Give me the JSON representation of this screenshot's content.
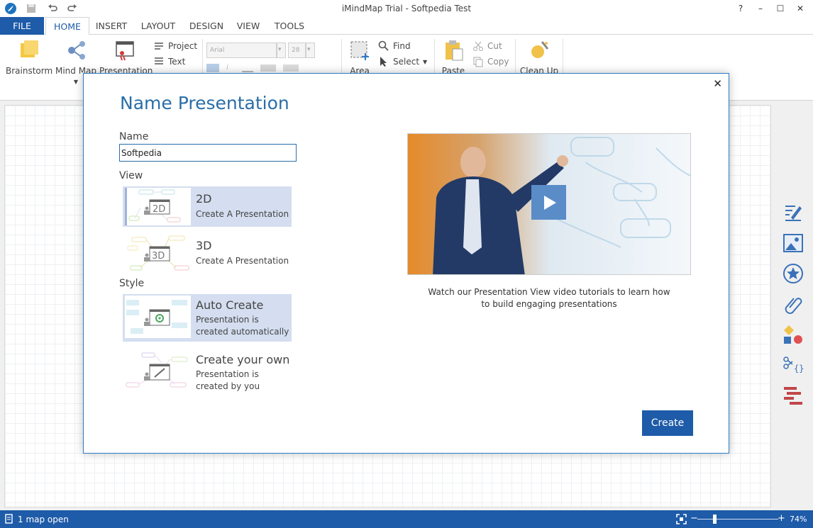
{
  "window": {
    "title": "iMindMap Trial - Softpedia Test"
  },
  "titlebar": {
    "help": "?",
    "minimize": "–",
    "maximize": "☐",
    "close": "✕"
  },
  "ribbon_tabs": [
    {
      "label": "FILE"
    },
    {
      "label": "HOME"
    },
    {
      "label": "INSERT"
    },
    {
      "label": "LAYOUT"
    },
    {
      "label": "DESIGN"
    },
    {
      "label": "VIEW"
    },
    {
      "label": "TOOLS"
    }
  ],
  "ribbon": {
    "brainstorm": "Brainstorm",
    "mind_map": "Mind Map",
    "presentation": "Presentation",
    "project": "Project",
    "text": "Text",
    "font_name": "Arial",
    "font_size": "28",
    "area": "Area",
    "find": "Find",
    "select": "Select",
    "paste": "Paste",
    "cut": "Cut",
    "copy": "Copy",
    "clean_up": "Clean Up"
  },
  "dialog": {
    "title": "Name Presentation",
    "close": "✕",
    "name_label": "Name",
    "name_value": "Softpedia",
    "view_label": "View",
    "view_options": [
      {
        "title": "2D",
        "subtitle": "Create A Presentation",
        "selected": true
      },
      {
        "title": "3D",
        "subtitle": "Create A Presentation",
        "selected": false
      }
    ],
    "style_label": "Style",
    "style_options": [
      {
        "title": "Auto Create",
        "subtitle_line1": "Presentation is",
        "subtitle_line2": "created automatically",
        "selected": true
      },
      {
        "title": "Create your own",
        "subtitle_line1": "Presentation is",
        "subtitle_line2": "created by you",
        "selected": false
      }
    ],
    "video_caption_line1": "Watch our Presentation View video tutorials to learn how",
    "video_caption_line2": "to build engaging presentations",
    "create_button": "Create"
  },
  "statusbar": {
    "maps_open": "1 map open",
    "zoom_minus": "−",
    "zoom_plus": "+",
    "zoom_level": "74%",
    "zoom_fraction": 0.2
  },
  "colors": {
    "brand_blue": "#1e5ba8",
    "selection": "#d4def0",
    "title_blue": "#2a6ea8"
  }
}
